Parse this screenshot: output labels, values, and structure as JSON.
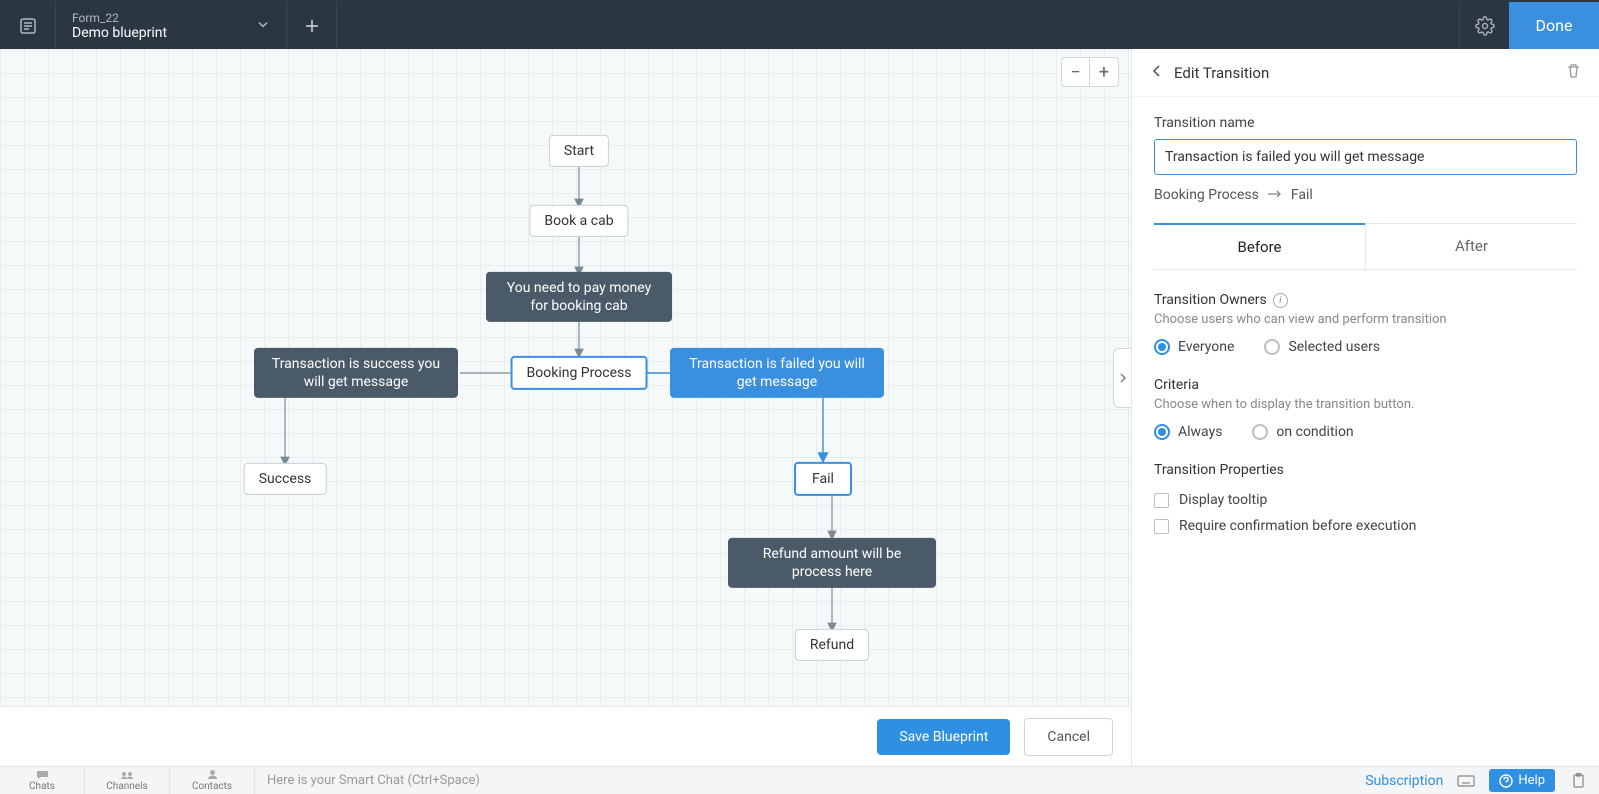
{
  "topbar": {
    "form_name": "Form_22",
    "blueprint_name": "Demo blueprint",
    "done_label": "Done"
  },
  "zoom": {
    "minus": "−",
    "plus": "+"
  },
  "nodes": {
    "start": "Start",
    "book": "Book a cab",
    "pay": "You need to pay money for booking cab",
    "success_trans": "Transaction is success you will get message",
    "booking": "Booking Process",
    "fail_trans": "Transaction is failed you will get message",
    "success": "Success",
    "fail": "Fail",
    "refund_trans": "Refund amount will be process here",
    "refund": "Refund"
  },
  "footer": {
    "save": "Save Blueprint",
    "cancel": "Cancel"
  },
  "panel": {
    "title": "Edit Transition",
    "name_label": "Transition name",
    "name_value": "Transaction is failed you will get message",
    "from_state": "Booking Process",
    "to_state": "Fail",
    "tabs": {
      "before": "Before",
      "after": "After"
    },
    "owners_title": "Transition Owners",
    "owners_sub": "Choose users who can view and perform transition",
    "owners_opt1": "Everyone",
    "owners_opt2": "Selected users",
    "criteria_title": "Criteria",
    "criteria_sub": "Choose when to display the transition button.",
    "criteria_opt1": "Always",
    "criteria_opt2": "on condition",
    "props_title": "Transition Properties",
    "props_tooltip": "Display tooltip",
    "props_confirm": "Require confirmation before execution"
  },
  "bottombar": {
    "chats": "Chats",
    "channels": "Channels",
    "contacts": "Contacts",
    "smart": "Here is your Smart Chat (Ctrl+Space)",
    "subscription": "Subscription",
    "help": "Help"
  }
}
